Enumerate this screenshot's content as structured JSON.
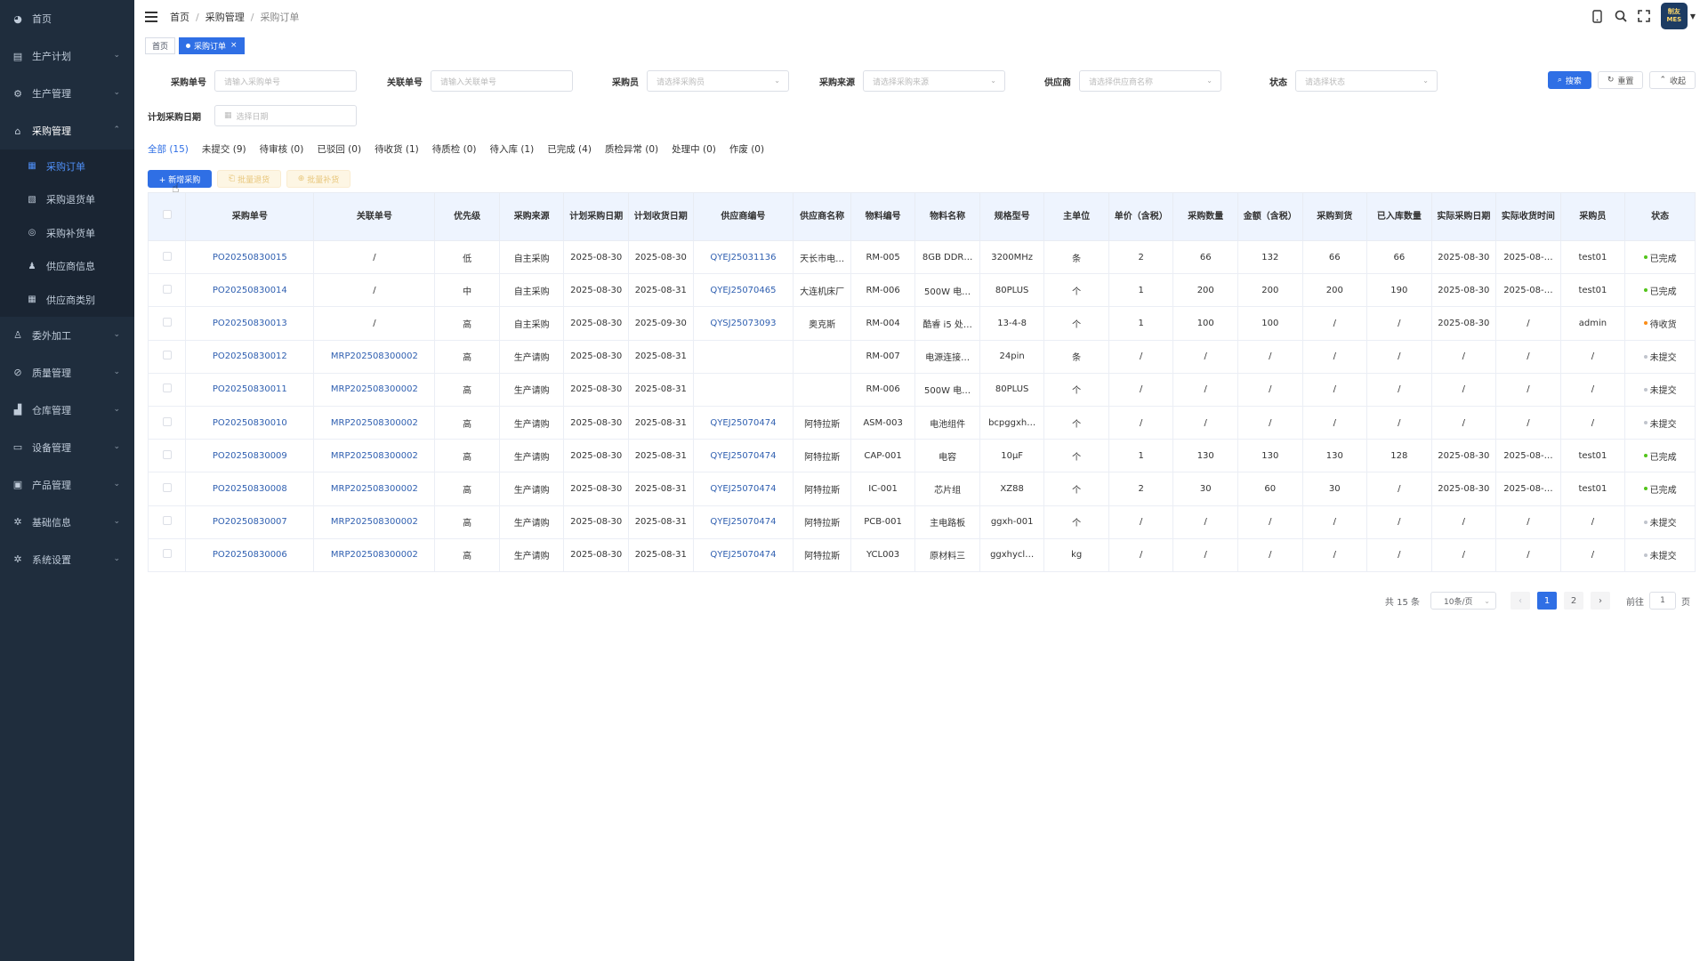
{
  "sidebar": {
    "items": [
      {
        "label": "首页",
        "icon": "dashboard-icon"
      },
      {
        "label": "生产计划",
        "icon": "calendar-icon"
      },
      {
        "label": "生产管理",
        "icon": "cog-icon"
      },
      {
        "label": "采购管理",
        "icon": "shopping-icon"
      },
      {
        "label": "委外加工",
        "icon": "outsource-icon"
      },
      {
        "label": "质量管理",
        "icon": "quality-icon"
      },
      {
        "label": "仓库管理",
        "icon": "warehouse-icon"
      },
      {
        "label": "设备管理",
        "icon": "monitor-icon"
      },
      {
        "label": "产品管理",
        "icon": "product-icon"
      },
      {
        "label": "基础信息",
        "icon": "gear-icon"
      },
      {
        "label": "系统设置",
        "icon": "settings-icon"
      }
    ],
    "purchase_sub": [
      {
        "label": "采购订单"
      },
      {
        "label": "采购退货单"
      },
      {
        "label": "采购补货单"
      },
      {
        "label": "供应商信息"
      },
      {
        "label": "供应商类别"
      }
    ]
  },
  "header": {
    "breadcrumb": [
      "首页",
      "采购管理",
      "采购订单"
    ],
    "avatar_line1": "制友",
    "avatar_line2": "MES"
  },
  "tags": {
    "home": "首页",
    "current": "采购订单"
  },
  "filters": {
    "order_no_label": "采购单号",
    "order_no_ph": "请输入采购单号",
    "rel_no_label": "关联单号",
    "rel_no_ph": "请输入关联单号",
    "buyer_label": "采购员",
    "buyer_ph": "请选择采购员",
    "source_label": "采购来源",
    "source_ph": "请选择采购来源",
    "supplier_label": "供应商",
    "supplier_ph": "请选择供应商名称",
    "status_label": "状态",
    "status_ph": "请选择状态",
    "date_label": "计划采购日期",
    "date_ph": "选择日期",
    "search_btn": "搜索",
    "reset_btn": "重置",
    "collapse_btn": "收起"
  },
  "status_tabs": [
    "全部 (15)",
    "未提交 (9)",
    "待审核 (0)",
    "已驳回 (0)",
    "待收货 (1)",
    "待质检 (0)",
    "待入库 (1)",
    "已完成 (4)",
    "质检异常 (0)",
    "处理中 (0)",
    "作废 (0)"
  ],
  "actions": {
    "add": "+ 新增采购",
    "batch_return": "批量退货",
    "batch_replenish": "批量补货"
  },
  "table": {
    "headers": [
      "采购单号",
      "关联单号",
      "优先级",
      "采购来源",
      "计划采购日期",
      "计划收货日期",
      "供应商编号",
      "供应商名称",
      "物料编号",
      "物料名称",
      "规格型号",
      "主单位",
      "单价（含税）",
      "采购数量",
      "金额（含税）",
      "采购到货",
      "已入库数量",
      "实际采购日期",
      "实际收货时间",
      "采购员",
      "状态"
    ],
    "rows": [
      [
        "PO20250830015",
        "/",
        "低",
        "自主采购",
        "2025-08-30",
        "2025-08-30",
        "QYEJ25031136",
        "天长市电…",
        "RM-005",
        "8GB DDR…",
        "3200MHz",
        "条",
        "2",
        "66",
        "132",
        "66",
        "66",
        "2025-08-30",
        "2025-08-…",
        "test01",
        "已完成"
      ],
      [
        "PO20250830014",
        "/",
        "中",
        "自主采购",
        "2025-08-30",
        "2025-08-31",
        "QYEJ25070465",
        "大连机床厂",
        "RM-006",
        "500W 电…",
        "80PLUS",
        "个",
        "1",
        "200",
        "200",
        "200",
        "190",
        "2025-08-30",
        "2025-08-…",
        "test01",
        "已完成"
      ],
      [
        "PO20250830013",
        "/",
        "高",
        "自主采购",
        "2025-08-30",
        "2025-09-30",
        "QYSJ25073093",
        "奥克斯",
        "RM-004",
        "酷睿 i5 处…",
        "13-4-8",
        "个",
        "1",
        "100",
        "100",
        "/",
        "/",
        "2025-08-30",
        "/",
        "admin",
        "待收货"
      ],
      [
        "PO20250830012",
        "MRP202508300002",
        "高",
        "生产请购",
        "2025-08-30",
        "2025-08-31",
        "",
        "",
        "RM-007",
        "电源连接…",
        "24pin",
        "条",
        "/",
        "/",
        "/",
        "/",
        "/",
        "/",
        "/",
        "/",
        "未提交"
      ],
      [
        "PO20250830011",
        "MRP202508300002",
        "高",
        "生产请购",
        "2025-08-30",
        "2025-08-31",
        "",
        "",
        "RM-006",
        "500W 电…",
        "80PLUS",
        "个",
        "/",
        "/",
        "/",
        "/",
        "/",
        "/",
        "/",
        "/",
        "未提交"
      ],
      [
        "PO20250830010",
        "MRP202508300002",
        "高",
        "生产请购",
        "2025-08-30",
        "2025-08-31",
        "QYEJ25070474",
        "阿特拉斯",
        "ASM-003",
        "电池组件",
        "bcpggxh…",
        "个",
        "/",
        "/",
        "/",
        "/",
        "/",
        "/",
        "/",
        "/",
        "未提交"
      ],
      [
        "PO20250830009",
        "MRP202508300002",
        "高",
        "生产请购",
        "2025-08-30",
        "2025-08-31",
        "QYEJ25070474",
        "阿特拉斯",
        "CAP-001",
        "电容",
        "10μF",
        "个",
        "1",
        "130",
        "130",
        "130",
        "128",
        "2025-08-30",
        "2025-08-…",
        "test01",
        "已完成"
      ],
      [
        "PO20250830008",
        "MRP202508300002",
        "高",
        "生产请购",
        "2025-08-30",
        "2025-08-31",
        "QYEJ25070474",
        "阿特拉斯",
        "IC-001",
        "芯片组",
        "XZ88",
        "个",
        "2",
        "30",
        "60",
        "30",
        "/",
        "2025-08-30",
        "2025-08-…",
        "test01",
        "已完成"
      ],
      [
        "PO20250830007",
        "MRP202508300002",
        "高",
        "生产请购",
        "2025-08-30",
        "2025-08-31",
        "QYEJ25070474",
        "阿特拉斯",
        "PCB-001",
        "主电路板",
        "ggxh-001",
        "个",
        "/",
        "/",
        "/",
        "/",
        "/",
        "/",
        "/",
        "/",
        "未提交"
      ],
      [
        "PO20250830006",
        "MRP202508300002",
        "高",
        "生产请购",
        "2025-08-30",
        "2025-08-31",
        "QYEJ25070474",
        "阿特拉斯",
        "YCL003",
        "原材料三",
        "ggxhycl…",
        "kg",
        "/",
        "/",
        "/",
        "/",
        "/",
        "/",
        "/",
        "/",
        "未提交"
      ]
    ]
  },
  "status_colors": {
    "已完成": "#52c41a",
    "待收货": "#fa8c16",
    "未提交": "#c0c4cc"
  },
  "pager": {
    "total": "共 15 条",
    "size": "10条/页",
    "pages": [
      "1",
      "2"
    ],
    "goto_label": "前往",
    "goto_value": "1",
    "page_unit": "页"
  }
}
